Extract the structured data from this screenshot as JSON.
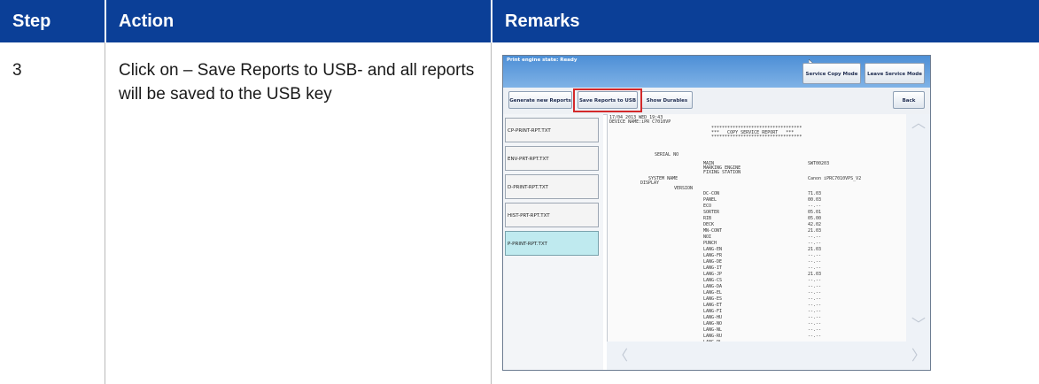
{
  "table": {
    "headers": {
      "step": "Step",
      "action": "Action",
      "remarks": "Remarks"
    },
    "rows": [
      {
        "step": "3",
        "action": "Click on – Save Reports to USB- and all reports will be saved to the USB key"
      }
    ]
  },
  "screenshot": {
    "status_text": "Print engine state: Ready",
    "buttons": {
      "service_copy_mode": "Service Copy Mode",
      "leave_service_mode": "Leave Service Mode",
      "generate_new_reports": "Generate new Reports",
      "save_reports_to_usb": "Save Reports to USB",
      "show_durables": "Show Durables",
      "back": "Back"
    },
    "files": [
      "CP-PRINT-RPT.TXT",
      "ENV-PRT-RPT.TXT",
      "D-PRINT-RPT.TXT",
      "HIST-PRT-RPT.TXT",
      "P-PRINT-RPT.TXT"
    ],
    "selected_file": "P-PRINT-RPT.TXT",
    "report": {
      "header_date": "17/04 2013 WED 19:43",
      "device_name": "DEVICE NAME:iPR C7010VP",
      "stars": "**********************************",
      "title": "***   COPY SERVICE REPORT   ***",
      "serial_label": "SERIAL NO",
      "serial_rows": [
        {
          "label": "MAIN",
          "value": "SWT00203"
        },
        {
          "label": "MARKING ENGINE",
          "value": ""
        },
        {
          "label": "FIXING STATION",
          "value": ""
        }
      ],
      "system_name_label": "SYSTEM NAME",
      "system_name_value": "Canon iPRC7010VPS_V2",
      "display_label": "DISPLAY",
      "version_label": "VERSION",
      "versions": [
        {
          "label": "DC-CON",
          "value": "71.03"
        },
        {
          "label": "PANEL",
          "value": "00.03"
        },
        {
          "label": "ECO",
          "value": "--.--"
        },
        {
          "label": "SORTER",
          "value": "05.01"
        },
        {
          "label": "RIB",
          "value": "05.00"
        },
        {
          "label": "DECK",
          "value": "42.02"
        },
        {
          "label": "MN-CONT",
          "value": "21.03"
        },
        {
          "label": "NOI",
          "value": "--.--"
        },
        {
          "label": "PUNCH",
          "value": "--.--"
        },
        {
          "label": "LANG-EN",
          "value": "21.03"
        },
        {
          "label": "LANG-FR",
          "value": "--.--"
        },
        {
          "label": "LANG-DE",
          "value": "--.--"
        },
        {
          "label": "LANG-IT",
          "value": "--.--"
        },
        {
          "label": "LANG-JP",
          "value": "21.03"
        },
        {
          "label": "LANG-CS",
          "value": "--.--"
        },
        {
          "label": "LANG-DA",
          "value": "--.--"
        },
        {
          "label": "LANG-EL",
          "value": "--.--"
        },
        {
          "label": "LANG-ES",
          "value": "--.--"
        },
        {
          "label": "LANG-ET",
          "value": "--.--"
        },
        {
          "label": "LANG-FI",
          "value": "--.--"
        },
        {
          "label": "LANG-HU",
          "value": "--.--"
        },
        {
          "label": "LANG-NO",
          "value": "--.--"
        },
        {
          "label": "LANG-NL",
          "value": "--.--"
        },
        {
          "label": "LANG-RU",
          "value": "--.--"
        },
        {
          "label": "LANG-PL",
          "value": "--.--"
        },
        {
          "label": "LANG-PT",
          "value": "--.--"
        },
        {
          "label": "LANG-RO",
          "value": "--.--"
        }
      ]
    }
  },
  "colors": {
    "header_bg": "#0b3f97",
    "highlight": "#d3292a",
    "selected_file": "#bfeaef"
  },
  "icons": [
    "cursor-icon",
    "scroll-up-arrow-icon",
    "scroll-down-arrow-icon",
    "scroll-left-arrow-icon",
    "scroll-right-arrow-icon"
  ]
}
